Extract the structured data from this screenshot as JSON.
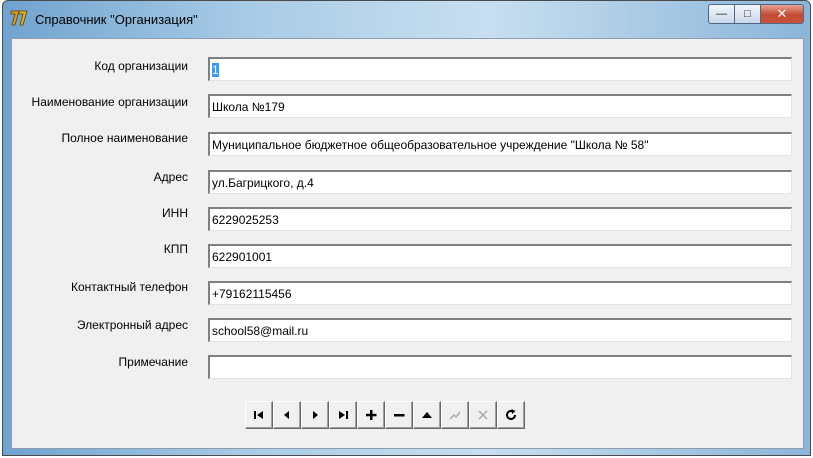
{
  "window": {
    "title": "Справочник \"Организация\"",
    "caption": {
      "minimize": "—",
      "maximize": "□",
      "close": "✕"
    }
  },
  "form": {
    "fields": [
      {
        "label": "Код организации",
        "value": "1"
      },
      {
        "label": "Наименование организации",
        "value": "Школа №179"
      },
      {
        "label": "Полное наименование",
        "value": "Муниципальное бюджетное общеобразовательное учреждение \"Школа № 58\""
      },
      {
        "label": "Адрес",
        "value": "ул.Багрицкого, д.4"
      },
      {
        "label": "ИНН",
        "value": "6229025253"
      },
      {
        "label": "КПП",
        "value": "622901001"
      },
      {
        "label": "Контактный телефон",
        "value": "+79162115456"
      },
      {
        "label": "Электронный адрес",
        "value": "school58@mail.ru"
      },
      {
        "label": "Примечание",
        "value": ""
      }
    ]
  },
  "navigator": {
    "buttons": [
      {
        "name": "first-record-icon",
        "enabled": true
      },
      {
        "name": "prior-record-icon",
        "enabled": true
      },
      {
        "name": "next-record-icon",
        "enabled": true
      },
      {
        "name": "last-record-icon",
        "enabled": true
      },
      {
        "name": "insert-record-icon",
        "enabled": true
      },
      {
        "name": "delete-record-icon",
        "enabled": true
      },
      {
        "name": "edit-record-icon",
        "enabled": true
      },
      {
        "name": "post-record-icon",
        "enabled": false
      },
      {
        "name": "cancel-edit-icon",
        "enabled": false
      },
      {
        "name": "refresh-icon",
        "enabled": true
      }
    ]
  },
  "colors": {
    "selection": "#3399ff",
    "form_background": "#f0f0f0",
    "close_button": "#c44b32",
    "disabled_glyph": "#a8a8a8"
  }
}
